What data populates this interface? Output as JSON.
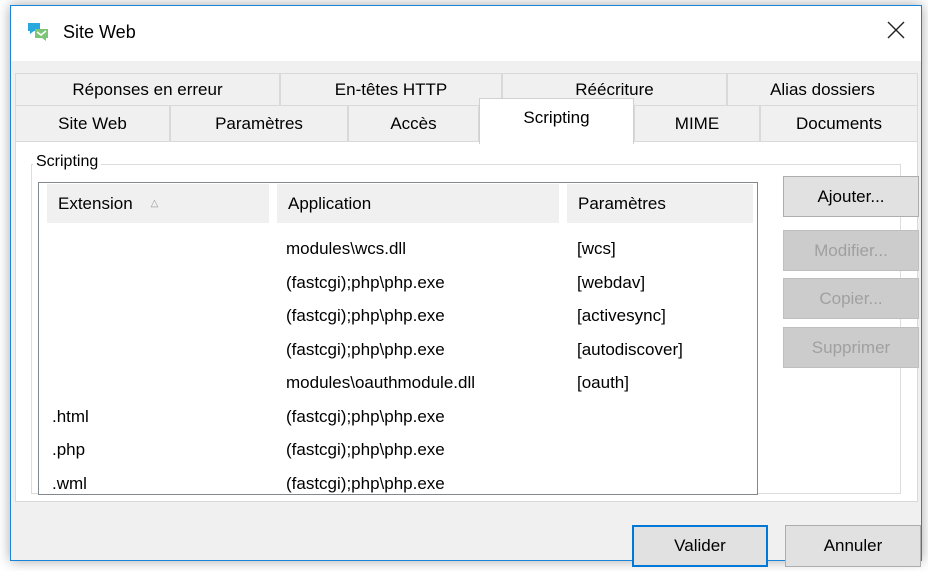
{
  "window": {
    "title": "Site Web",
    "accent_color": "#0078d7"
  },
  "tabs": {
    "row1": [
      {
        "label": "Réponses en erreur"
      },
      {
        "label": "En-têtes HTTP"
      },
      {
        "label": "Réécriture"
      },
      {
        "label": "Alias dossiers"
      }
    ],
    "row2": [
      {
        "label": "Site Web"
      },
      {
        "label": "Paramètres"
      },
      {
        "label": "Accès"
      },
      {
        "label": "Scripting",
        "active": true
      },
      {
        "label": "MIME"
      },
      {
        "label": "Documents"
      }
    ]
  },
  "group": {
    "title": "Scripting"
  },
  "table": {
    "columns": [
      "Extension",
      "Application",
      "Paramètres"
    ],
    "sorted_column": "Extension",
    "rows": [
      {
        "extension": "",
        "application": "modules\\wcs.dll",
        "parameters": "[wcs]"
      },
      {
        "extension": "",
        "application": "(fastcgi);php\\php.exe",
        "parameters": "[webdav]"
      },
      {
        "extension": "",
        "application": "(fastcgi);php\\php.exe",
        "parameters": "[activesync]"
      },
      {
        "extension": "",
        "application": "(fastcgi);php\\php.exe",
        "parameters": "[autodiscover]"
      },
      {
        "extension": "",
        "application": "modules\\oauthmodule.dll",
        "parameters": "[oauth]"
      },
      {
        "extension": ".html",
        "application": "(fastcgi);php\\php.exe",
        "parameters": ""
      },
      {
        "extension": ".php",
        "application": "(fastcgi);php\\php.exe",
        "parameters": ""
      },
      {
        "extension": ".wml",
        "application": "(fastcgi);php\\php.exe",
        "parameters": ""
      }
    ]
  },
  "side_buttons": [
    {
      "label": "Ajouter...",
      "enabled": true
    },
    {
      "label": "Modifier...",
      "enabled": false
    },
    {
      "label": "Copier...",
      "enabled": false
    },
    {
      "label": "Supprimer",
      "enabled": false
    }
  ],
  "footer": {
    "ok_label": "Valider",
    "cancel_label": "Annuler"
  },
  "icons": {
    "app": "chat-bubble-icon",
    "close": "close-icon",
    "sort": "sort-ascending-icon"
  }
}
